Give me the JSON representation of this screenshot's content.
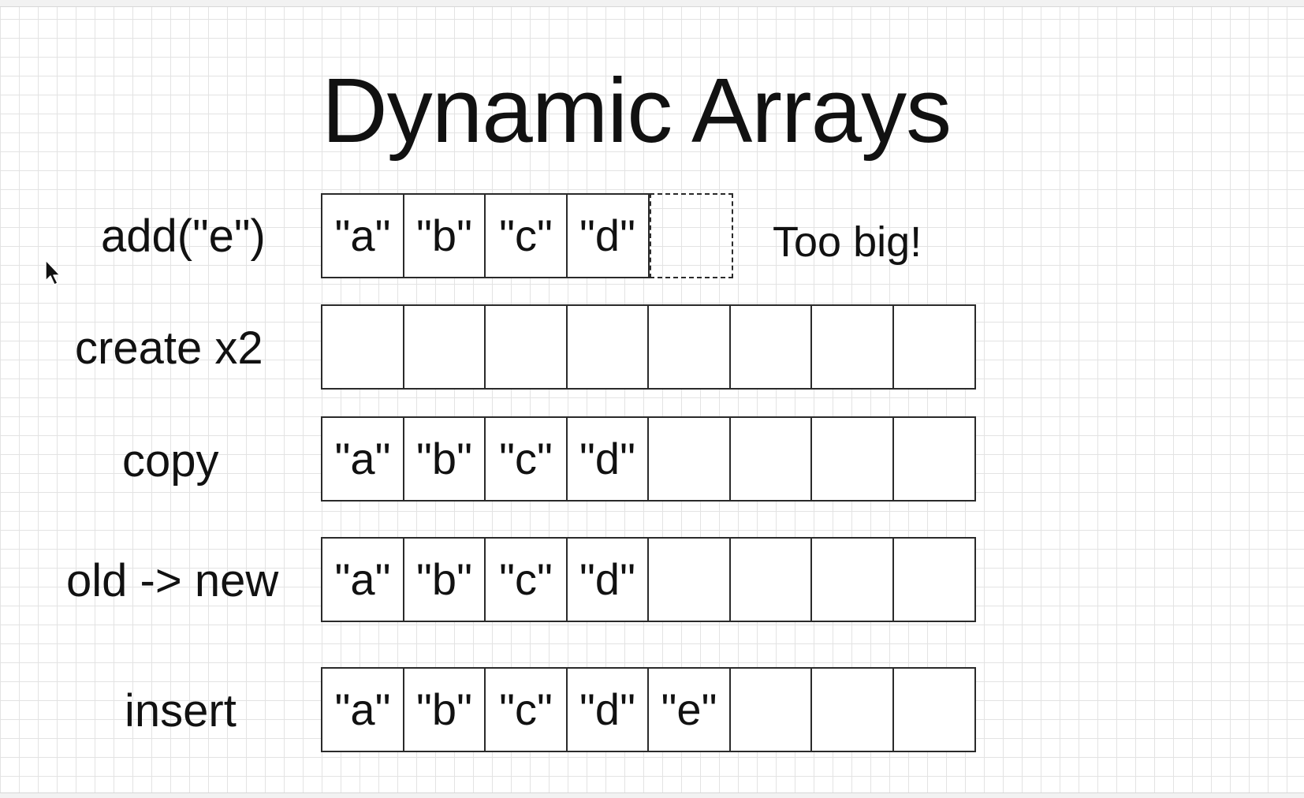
{
  "title": "Dynamic Arrays",
  "rows": [
    {
      "label": "add(\"e\")",
      "cells": [
        "\"a\"",
        "\"b\"",
        "\"c\"",
        "\"d\""
      ],
      "pending_cell": "",
      "note": "Too big!"
    },
    {
      "label": "create x2",
      "cells": [
        "",
        "",
        "",
        "",
        "",
        "",
        "",
        ""
      ]
    },
    {
      "label": "copy",
      "cells": [
        "\"a\"",
        "\"b\"",
        "\"c\"",
        "\"d\"",
        "",
        "",
        "",
        ""
      ]
    },
    {
      "label": "old -> new",
      "cells": [
        "\"a\"",
        "\"b\"",
        "\"c\"",
        "\"d\"",
        "",
        "",
        "",
        ""
      ]
    },
    {
      "label": "insert",
      "cells": [
        "\"a\"",
        "\"b\"",
        "\"c\"",
        "\"d\"",
        "\"e\"",
        "",
        "",
        ""
      ]
    }
  ],
  "icons": {
    "cursor": "mouse-pointer-icon"
  }
}
